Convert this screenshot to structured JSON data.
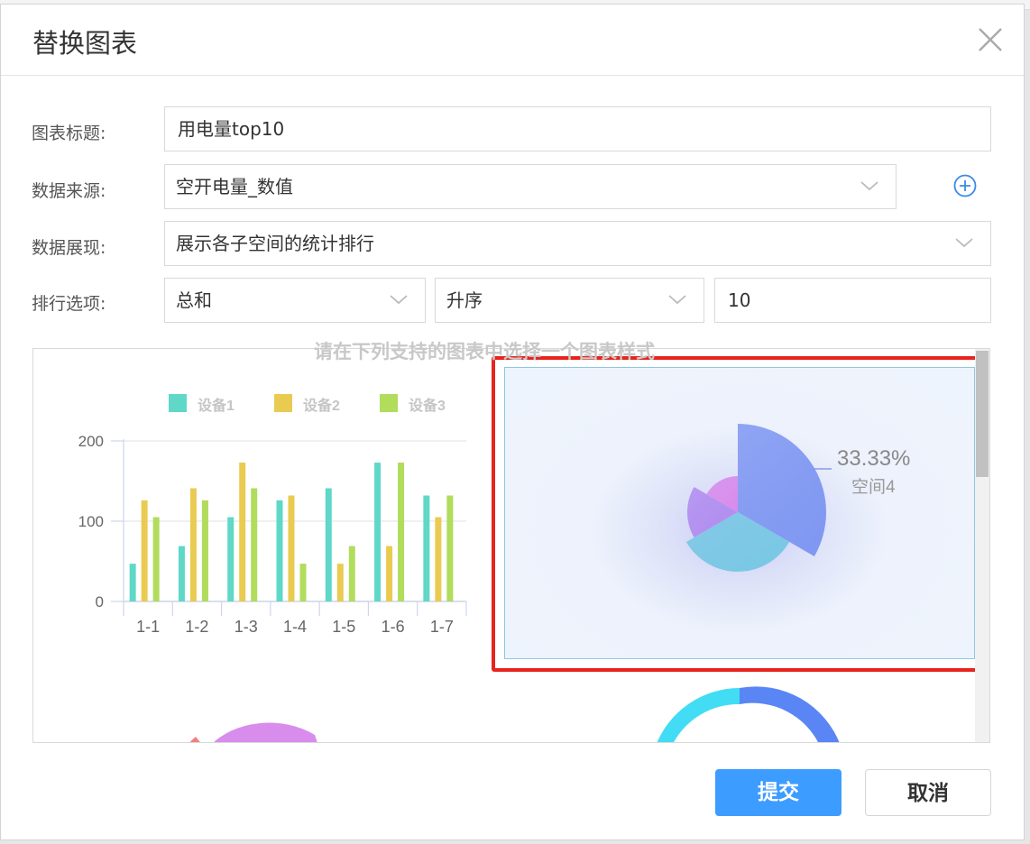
{
  "dialog": {
    "title": "替换图表",
    "close_icon": "close-icon"
  },
  "form": {
    "chart_title": {
      "label": "图表标题:",
      "value": "用电量top10"
    },
    "data_source": {
      "label": "数据来源:",
      "value": "空开电量_数值"
    },
    "data_display": {
      "label": "数据展现:",
      "value": "展示各子空间的统计排行"
    },
    "ranking": {
      "label": "排行选项:",
      "aggregate": "总和",
      "order": "升序",
      "count": "10"
    }
  },
  "gallery": {
    "hint": "请在下列支持的图表中选择一个图表样式"
  },
  "chart_data": [
    {
      "type": "bar",
      "categories": [
        "1-1",
        "1-2",
        "1-3",
        "1-4",
        "1-5",
        "1-6",
        "1-7"
      ],
      "series": [
        {
          "name": "设备1",
          "values": [
            47,
            69,
            105,
            126,
            141,
            173,
            132
          ],
          "color": "#5fd8c8"
        },
        {
          "name": "设备2",
          "values": [
            126,
            141,
            173,
            132,
            47,
            69,
            105
          ],
          "color": "#eacb51"
        },
        {
          "name": "设备3",
          "values": [
            105,
            126,
            141,
            47,
            69,
            173,
            132
          ],
          "color": "#b1dc5c"
        }
      ],
      "yticks": [
        "0",
        "100",
        "200"
      ],
      "ylim": [
        0,
        200
      ],
      "legend": "top",
      "grid": true
    },
    {
      "type": "pie",
      "subtype": "rose",
      "label_value": "33.33%",
      "label_name": "空间4",
      "slices": [
        {
          "value": 33.33,
          "color": "#7f97f2"
        },
        {
          "value": 33.33,
          "color": "#77c7e4"
        },
        {
          "value": 16.67,
          "color": "#b18cf0"
        },
        {
          "value": 16.67,
          "color": "#d88cec"
        }
      ]
    }
  ],
  "buttons": {
    "submit": "提交",
    "cancel": "取消"
  }
}
